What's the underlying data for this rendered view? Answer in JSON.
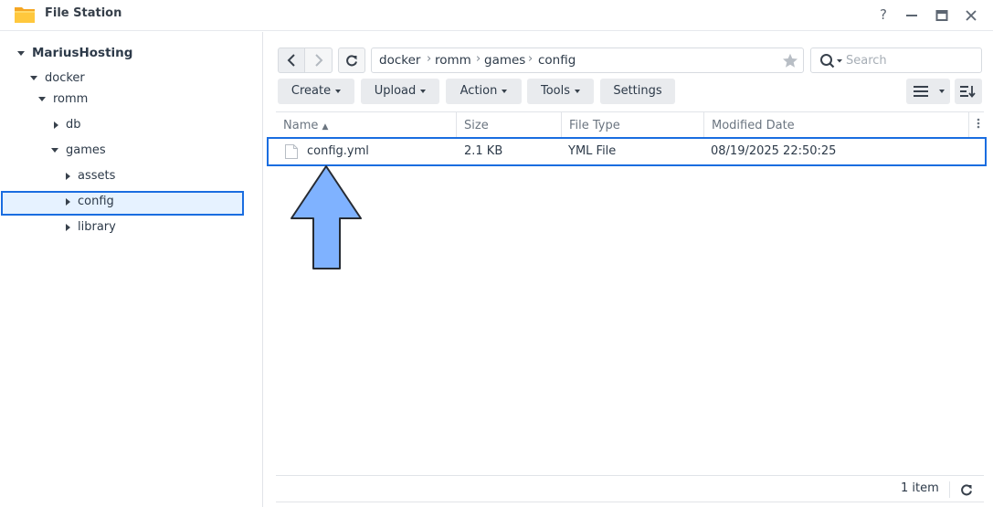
{
  "window": {
    "title": "File Station",
    "icons": {
      "app": "folder-icon",
      "help": "help-icon",
      "minimize": "minimize-icon",
      "maximize": "maximize-icon",
      "close": "close-icon"
    },
    "help_glyph": "?"
  },
  "tree": {
    "root": "MariusHosting",
    "items": [
      {
        "label": "docker",
        "expanded": true
      },
      {
        "label": "romm",
        "expanded": true
      },
      {
        "label": "db",
        "expanded": false
      },
      {
        "label": "games",
        "expanded": true
      },
      {
        "label": "assets",
        "expanded": false
      },
      {
        "label": "config",
        "expanded": false,
        "selected": true
      },
      {
        "label": "library",
        "expanded": false
      }
    ]
  },
  "toolbar": {
    "path": [
      "docker",
      "romm",
      "games",
      "config"
    ],
    "search_placeholder": "Search",
    "buttons": {
      "create": "Create",
      "upload": "Upload",
      "action": "Action",
      "tools": "Tools",
      "settings": "Settings"
    },
    "icons": {
      "back": "chevron-left-icon",
      "forward": "chevron-right-icon",
      "refresh": "refresh-icon",
      "favorite": "star-icon",
      "search": "search-icon",
      "view": "list-view-icon",
      "sort": "sort-icon"
    }
  },
  "file_list": {
    "columns": {
      "name": "Name",
      "size": "Size",
      "type": "File Type",
      "modified": "Modified Date"
    },
    "sort": {
      "column": "name",
      "direction": "ascending"
    },
    "rows": [
      {
        "name": "config.yml",
        "size": "2.1 KB",
        "type": "YML File",
        "modified": "08/19/2025 22:50:25"
      }
    ]
  },
  "footer": {
    "count": "1 item"
  },
  "colors": {
    "accent": "#1a6de0",
    "arrow_fill": "#7fb2ff",
    "selection_bg": "#e6f2ff"
  }
}
